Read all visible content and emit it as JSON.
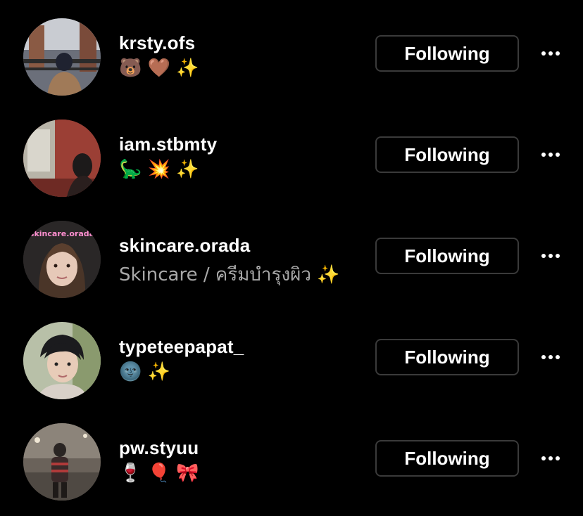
{
  "following_list": [
    {
      "username": "krsty.ofs",
      "subtitle": "🐻 🤎 ✨",
      "button_label": "Following",
      "avatar": "avatar-photo"
    },
    {
      "username": "iam.stbmty",
      "subtitle": "🦕 💥 ✨",
      "button_label": "Following",
      "avatar": "avatar-photo"
    },
    {
      "username": "skincare.orada",
      "subtitle": "Skincare / ครีมบำรุงผิว ✨",
      "button_label": "Following",
      "avatar": "avatar-photo",
      "avatar_overlay_text": "♡skincare.orada♡"
    },
    {
      "username": "typeteepapat_",
      "subtitle": "🌚 ✨",
      "button_label": "Following",
      "avatar": "avatar-photo"
    },
    {
      "username": "pw.styuu",
      "subtitle": "🍷 🎈 🎀",
      "button_label": "Following",
      "avatar": "avatar-photo"
    }
  ],
  "more_icon": "more-horizontal-icon",
  "colors": {
    "background": "#000000",
    "text_primary": "#ffffff",
    "text_secondary": "#a8a8a8",
    "button_border": "#3a3a3a"
  }
}
